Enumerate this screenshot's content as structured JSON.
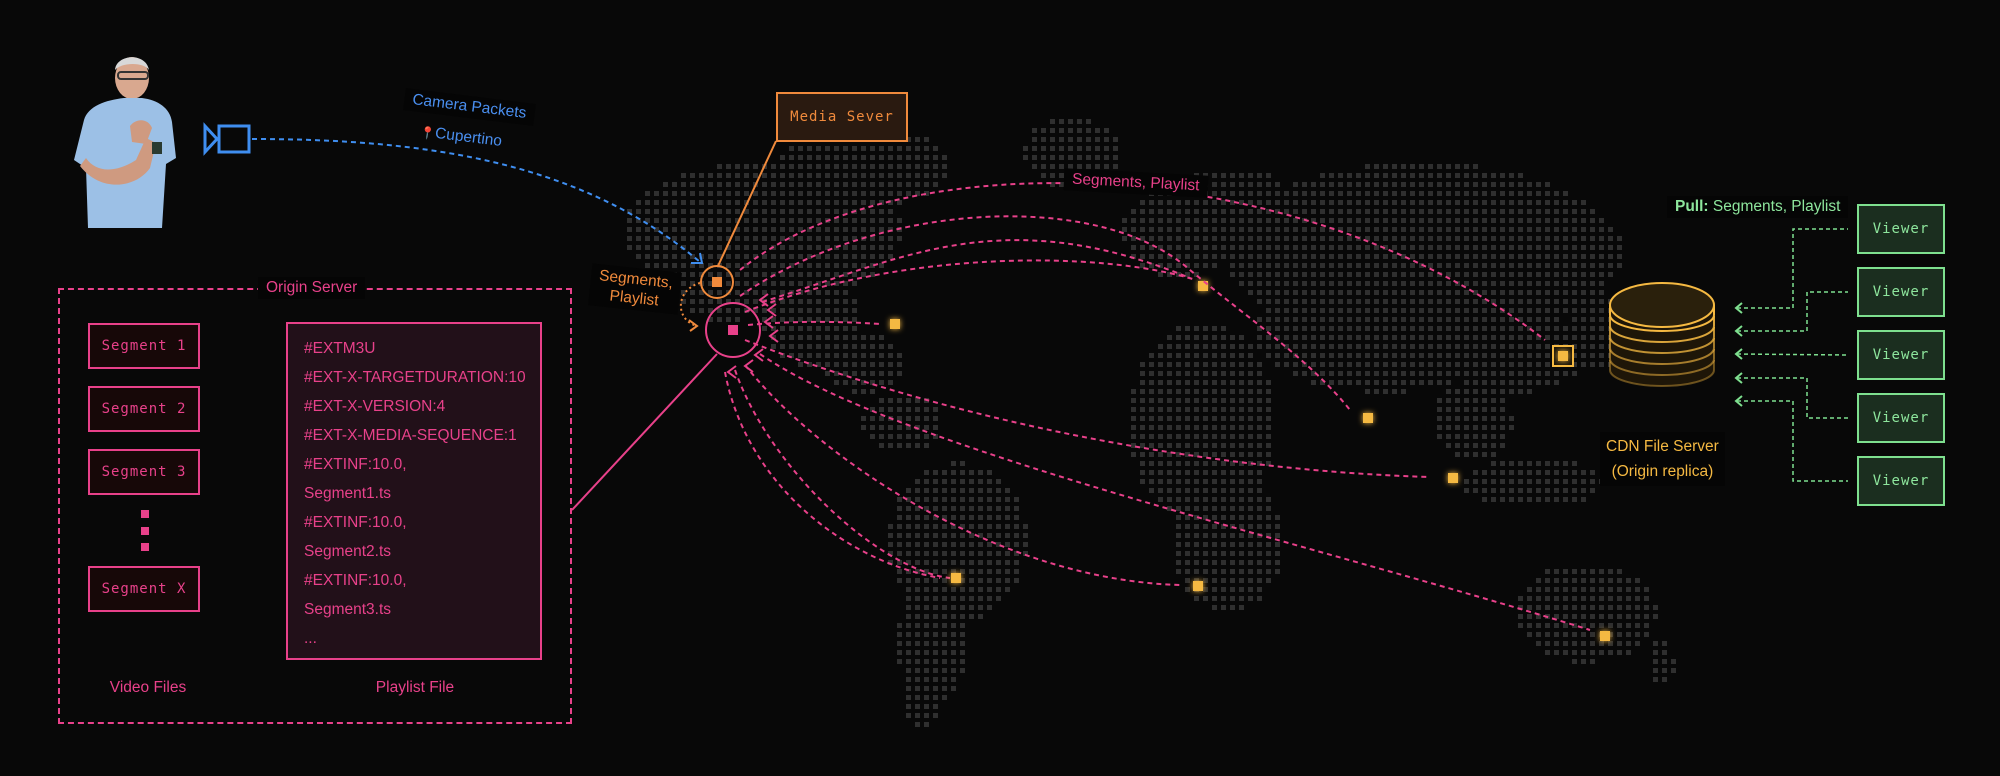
{
  "presenter": {
    "alt": "Presenter on stage"
  },
  "camera": {
    "icon": "video-camera-icon"
  },
  "camera_link": {
    "line1": "Camera Packets",
    "line2": "Cupertino",
    "pin_icon": "📍"
  },
  "media_server": {
    "label": "Media Sever"
  },
  "ingest_label": {
    "line1": "Segments,",
    "line2": "Playlist"
  },
  "origin_server": {
    "title": "Origin Server",
    "segments": [
      "Segment 1",
      "Segment 2",
      "Segment 3",
      "Segment X"
    ],
    "video_files_label": "Video Files",
    "playlist_label": "Playlist File",
    "playlist_lines": [
      "#EXTM3U",
      "#EXT-X-TARGETDURATION:10",
      "#EXT-X-VERSION:4",
      "#EXT-X-MEDIA-SEQUENCE:1",
      "#EXTINF:10.0,",
      "Segment1.ts",
      "#EXTINF:10.0,",
      "Segment2.ts",
      "#EXTINF:10.0,",
      "Segment3.ts",
      "..."
    ]
  },
  "distribution_label": "Segments, Playlist",
  "cdn": {
    "line1": "CDN File Server",
    "line2": "(Origin replica)"
  },
  "pull_label": {
    "bold": "Pull:",
    "rest": " Segments, Playlist"
  },
  "viewers": [
    "Viewer",
    "Viewer",
    "Viewer",
    "Viewer",
    "Viewer"
  ],
  "colors": {
    "background": "#080808",
    "origin_pink": "#e8418a",
    "media_orange": "#f08a3c",
    "camera_blue": "#3f8ef0",
    "cdn_gold": "#f5b942",
    "viewer_green": "#7ee08f",
    "map_dot": "#2f2f2f"
  }
}
